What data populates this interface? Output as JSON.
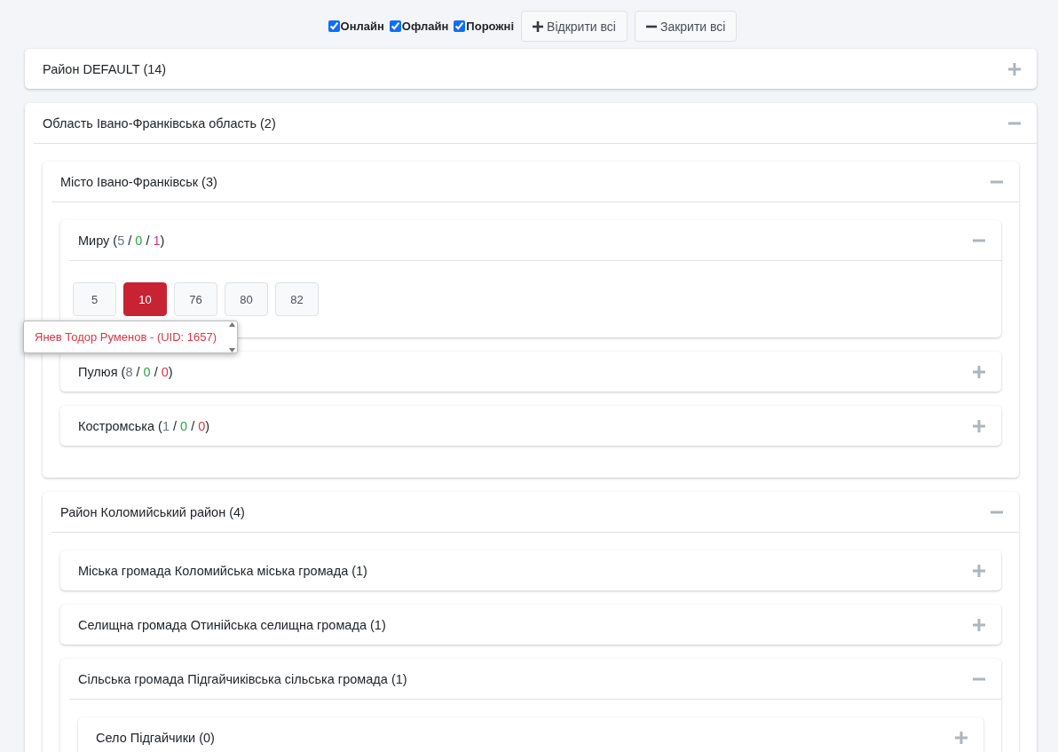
{
  "filters": [
    {
      "label": "Онлайн",
      "checked": true
    },
    {
      "label": "Офлайн",
      "checked": true
    },
    {
      "label": "Порожні",
      "checked": true
    }
  ],
  "toolbar_buttons": [
    {
      "kind": "expand",
      "label": "Відкрити всі"
    },
    {
      "kind": "collapse",
      "label": "Закрити всі"
    }
  ],
  "panels": [
    {
      "title": "Район DEFAULT (14)",
      "expanded": false
    },
    {
      "title": "Область Івано-Франківська область (2)",
      "expanded": true,
      "children": [
        {
          "title": "Місто Івано-Франківськ (3)",
          "expanded": true,
          "children": [
            {
              "title_parts": [
                {
                  "text": "Миру ("
                },
                {
                  "text": "5",
                  "color": "#6c757d"
                },
                {
                  "text": " / "
                },
                {
                  "text": "0",
                  "color": "#28a745"
                },
                {
                  "text": " / "
                },
                {
                  "text": "1",
                  "color": "#d63384"
                },
                {
                  "text": ")"
                }
              ],
              "expanded": true,
              "devices": [
                {
                  "label": "5",
                  "selected": false
                },
                {
                  "label": "10",
                  "selected": true
                },
                {
                  "label": "76",
                  "selected": false
                },
                {
                  "label": "80",
                  "selected": false
                },
                {
                  "label": "82",
                  "selected": false
                }
              ],
              "popup": {
                "text": "Янев Тодор Руменов - (UID: 1657)"
              }
            },
            {
              "title_parts": [
                {
                  "text": "Пулюя ("
                },
                {
                  "text": "8",
                  "color": "#6c757d"
                },
                {
                  "text": " / "
                },
                {
                  "text": "0",
                  "color": "#28a745"
                },
                {
                  "text": " / "
                },
                {
                  "text": "0",
                  "color": "#dc3545"
                },
                {
                  "text": ")"
                }
              ],
              "expanded": false
            },
            {
              "title_parts": [
                {
                  "text": "Костромська ("
                },
                {
                  "text": "1",
                  "color": "#6c757d"
                },
                {
                  "text": " / "
                },
                {
                  "text": "0",
                  "color": "#28a745"
                },
                {
                  "text": " / "
                },
                {
                  "text": "0",
                  "color": "#dc3545"
                },
                {
                  "text": ")"
                }
              ],
              "expanded": false
            }
          ]
        },
        {
          "title": "Район Коломийський район (4)",
          "expanded": true,
          "children": [
            {
              "title": "Міська громада Коломийська міська громада (1)",
              "expanded": false
            },
            {
              "title": "Селищна громада Отинійська селищна громада (1)",
              "expanded": false
            },
            {
              "title": "Сільська громада Підгайчиківська сільська громада (1)",
              "expanded": true,
              "children": [
                {
                  "title": "Село Підгайчики (0)",
                  "expanded": false
                }
              ]
            }
          ]
        }
      ]
    }
  ]
}
